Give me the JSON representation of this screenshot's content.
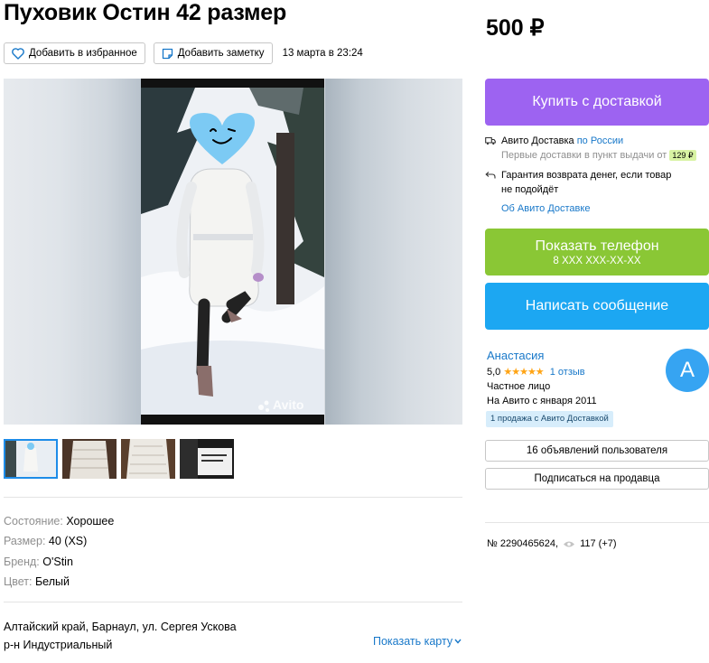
{
  "listing": {
    "title": "Пуховик Остин 42 размер",
    "price": "500 ₽",
    "favorite_label": "Добавить в избранное",
    "note_label": "Добавить заметку",
    "date": "13 марта в 23:24"
  },
  "gallery": {
    "watermark": "Avito",
    "thumb_count": 4
  },
  "params": [
    {
      "key": "Состояние:",
      "value": "Хорошее"
    },
    {
      "key": "Размер:",
      "value": "40 (XS)"
    },
    {
      "key": "Бренд:",
      "value": "O'Stin"
    },
    {
      "key": "Цвет:",
      "value": "Белый"
    }
  ],
  "address": {
    "line1": "Алтайский край, Барнаул, ул. Сергея Ускова",
    "line2": "р-н Индустриальный",
    "map_link": "Показать карту"
  },
  "buy_button": "Купить с доставкой",
  "delivery": {
    "service": "Авито Доставка",
    "scope": "по России",
    "first_delivery": "Первые доставки в пункт выдачи от",
    "first_delivery_price": "129 ₽",
    "guarantee_line1": "Гарантия возврата денег, если товар",
    "guarantee_line2": "не подойдёт",
    "about_link": "Об Авито Доставке"
  },
  "phone_button": {
    "label": "Показать телефон",
    "number": "8 XXX XXX-XX-XX"
  },
  "message_button": "Написать сообщение",
  "seller": {
    "name": "Анастасия",
    "rating": "5,0",
    "stars": "★★★★★",
    "reviews": "1 отзыв",
    "type": "Частное лицо",
    "since": "На Авито с января 2011",
    "badge": "1 продажа с Авито Доставкой",
    "avatar_letter": "А",
    "ads_button": "16 объявлений пользователя",
    "subscribe_button": "Подписаться на продавца"
  },
  "meta": {
    "id": "№ 2290465624,",
    "views": "117 (+7)"
  },
  "colors": {
    "buy": "#9d63f1",
    "phone": "#8ac735",
    "message": "#1ca7f2",
    "link": "#1878c9"
  }
}
